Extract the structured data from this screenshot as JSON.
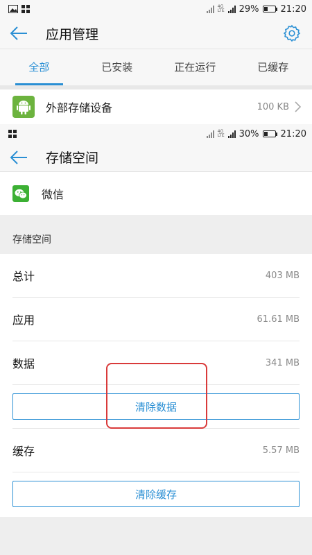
{
  "top_screen": {
    "status": {
      "battery": "29%",
      "time": "21:20",
      "battery_level": 0.29,
      "network_label": "4G"
    },
    "title": "应用管理",
    "tabs": [
      {
        "label": "全部",
        "active": true
      },
      {
        "label": "已安装",
        "active": false
      },
      {
        "label": "正在运行",
        "active": false
      },
      {
        "label": "已缓存",
        "active": false
      }
    ],
    "app_row": {
      "name": "外部存储设备",
      "size": "100 KB"
    }
  },
  "bottom_screen": {
    "status": {
      "battery": "30%",
      "time": "21:20",
      "battery_level": 0.3,
      "network_label": "4G"
    },
    "title": "存储空间",
    "app_name": "微信",
    "section_header": "存储空间",
    "rows": {
      "total": {
        "label": "总计",
        "value": "403 MB"
      },
      "app": {
        "label": "应用",
        "value": "61.61 MB"
      },
      "data": {
        "label": "数据",
        "value": "341 MB"
      },
      "cache": {
        "label": "缓存",
        "value": "5.57 MB"
      }
    },
    "clear_data_label": "清除数据",
    "clear_cache_label": "清除缓存"
  },
  "colors": {
    "accent": "#2a8fd4",
    "highlight": "#d93a3a",
    "android_green": "#6cb33e",
    "wechat_green": "#3cb034"
  }
}
